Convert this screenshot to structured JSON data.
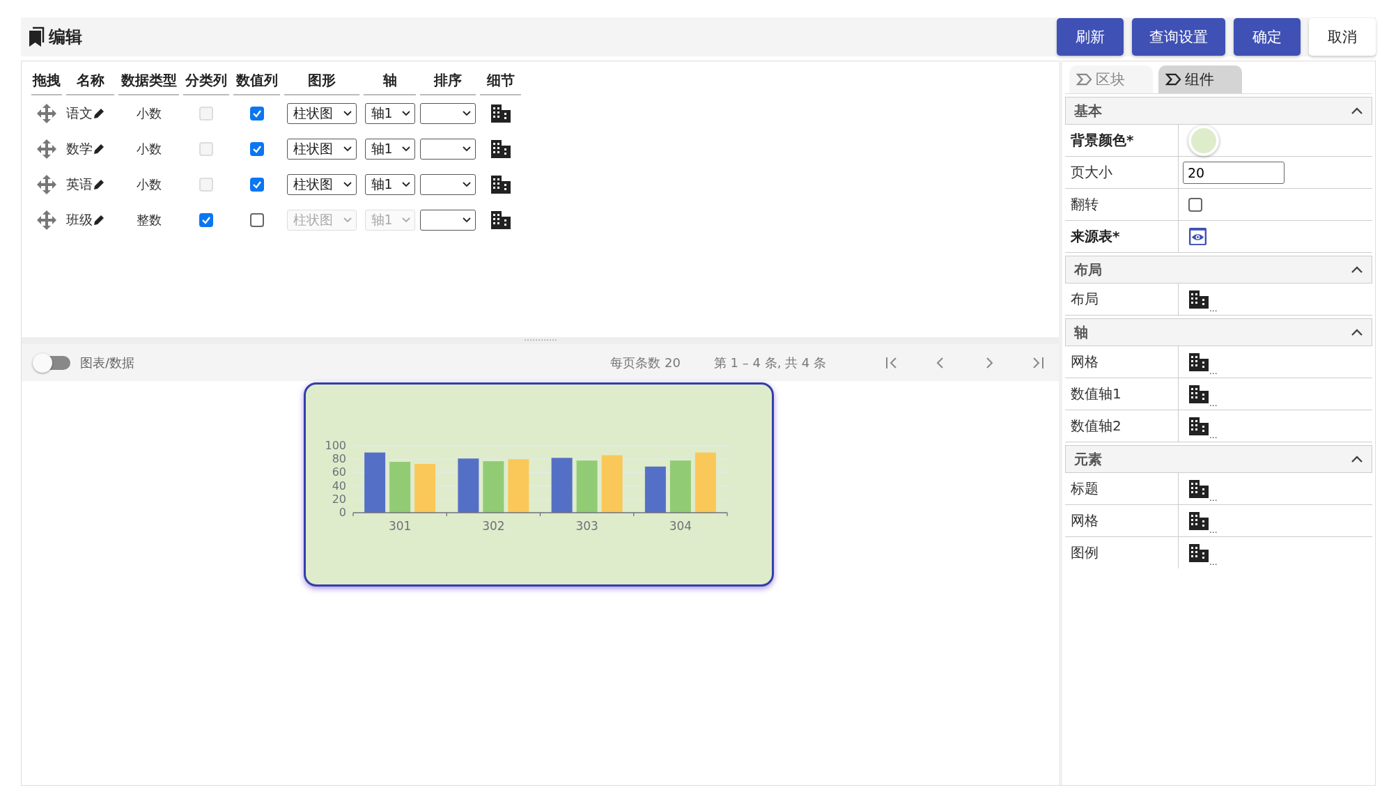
{
  "header": {
    "title": "编辑",
    "buttons": [
      {
        "label": "刷新",
        "kind": "primary"
      },
      {
        "label": "查询设置",
        "kind": "primary"
      },
      {
        "label": "确定",
        "kind": "primary"
      },
      {
        "label": "取消",
        "kind": "secondary"
      }
    ]
  },
  "fields_table": {
    "columns": [
      "拖拽",
      "名称",
      "数据类型",
      "分类列",
      "数值列",
      "图形",
      "轴",
      "排序",
      "细节"
    ],
    "rows": [
      {
        "name": "语文",
        "data_type": "小数",
        "category_column": false,
        "value_column": true,
        "shape": "柱状图",
        "axis": "轴1"
      },
      {
        "name": "数学",
        "data_type": "小数",
        "category_column": false,
        "value_column": true,
        "shape": "柱状图",
        "axis": "轴1"
      },
      {
        "name": "英语",
        "data_type": "小数",
        "category_column": false,
        "value_column": true,
        "shape": "柱状图",
        "axis": "轴1"
      },
      {
        "name": "班级",
        "data_type": "整数",
        "category_column": true,
        "value_column": false,
        "shape": "柱状图",
        "axis": "轴1"
      }
    ]
  },
  "toolbar": {
    "toggle_label": "图表/数据",
    "toggle_on": false,
    "page_size": "每页条数 20",
    "range": "第 1 – 4 条, 共 4 条"
  },
  "chart_data": {
    "type": "bar",
    "grid": true,
    "categories": [
      "301",
      "302",
      "303",
      "304"
    ],
    "ylim": [
      0,
      100
    ],
    "yticks": [
      0,
      20,
      40,
      60,
      80,
      100
    ],
    "series": [
      {
        "color": "#5470c6",
        "values": [
          90,
          81,
          82,
          69
        ]
      },
      {
        "color": "#91cc75",
        "values": [
          76,
          77,
          78,
          78
        ]
      },
      {
        "color": "#fac858",
        "values": [
          73,
          80,
          86,
          90
        ]
      }
    ]
  },
  "panel": {
    "tabs": [
      {
        "label": "区块",
        "selected": false
      },
      {
        "label": "组件",
        "selected": true
      }
    ],
    "sections": [
      {
        "title": "基本",
        "expanded": true,
        "properties": [
          {
            "label": "背景颜色*",
            "required": true,
            "kind": "color",
            "color": "#dfeccb"
          },
          {
            "label": "页大小",
            "required": false,
            "kind": "text",
            "value": "20"
          },
          {
            "label": "翻转",
            "required": false,
            "kind": "checkbox",
            "checked": false
          },
          {
            "label": "来源表*",
            "required": true,
            "kind": "view"
          }
        ]
      },
      {
        "title": "布局",
        "expanded": true,
        "properties": [
          {
            "label": "布局",
            "required": false,
            "kind": "detail",
            "more": "..."
          }
        ]
      },
      {
        "title": "轴",
        "expanded": true,
        "properties": [
          {
            "label": "网格",
            "required": false,
            "kind": "detail",
            "more": "..."
          },
          {
            "label": "数值轴1",
            "required": false,
            "kind": "detail",
            "more": "..."
          },
          {
            "label": "数值轴2",
            "required": false,
            "kind": "detail",
            "more": "..."
          }
        ]
      },
      {
        "title": "元素",
        "expanded": true,
        "properties": [
          {
            "label": "标题",
            "required": false,
            "kind": "detail",
            "more": "..."
          },
          {
            "label": "网格",
            "required": false,
            "kind": "detail",
            "more": "..."
          },
          {
            "label": "图例",
            "required": false,
            "kind": "detail",
            "more": "..."
          }
        ]
      }
    ]
  }
}
